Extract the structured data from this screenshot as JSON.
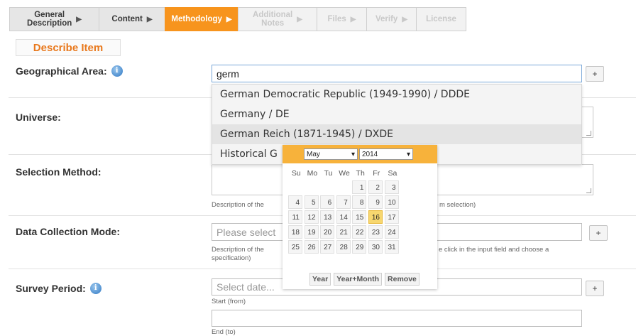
{
  "tabs": [
    {
      "label": "General\nDescription",
      "state": "normal"
    },
    {
      "label": "Content",
      "state": "normal"
    },
    {
      "label": "Methodology",
      "state": "active"
    },
    {
      "label": "Additional\nNotes",
      "state": "disabled"
    },
    {
      "label": "Files",
      "state": "disabled"
    },
    {
      "label": "Verify",
      "state": "disabled"
    },
    {
      "label": "License",
      "state": "disabled"
    }
  ],
  "section_title": "Describe Item",
  "fields": {
    "geo": {
      "label": "Geographical Area:",
      "value": "germ",
      "add": "+"
    },
    "universe": {
      "label": "Universe:"
    },
    "selection": {
      "label": "Selection Method:",
      "hint_left": "Description of the",
      "hint_right": "m selection)"
    },
    "collection": {
      "label": "Data Collection Mode:",
      "placeholder": "Please select",
      "add": "+",
      "hint_left": "Description of the\nspecification)",
      "hint_right": "e click in the input field and choose a"
    },
    "survey": {
      "label": "Survey Period:",
      "start_placeholder": "Select date...",
      "start_hint": "Start (from)",
      "end_hint": "End (to)",
      "add": "+"
    }
  },
  "autocomplete": [
    "German Democratic Republic (1949-1990) / DDDE",
    "Germany / DE",
    "German Reich (1871-1945) / DXDE",
    "Historical G"
  ],
  "datepicker": {
    "month": "May",
    "year": "2014",
    "weekdays": [
      "Su",
      "Mo",
      "Tu",
      "We",
      "Th",
      "Fr",
      "Sa"
    ],
    "weeks": [
      [
        "",
        "",
        "",
        "",
        "1",
        "2",
        "3"
      ],
      [
        "4",
        "5",
        "6",
        "7",
        "8",
        "9",
        "10"
      ],
      [
        "11",
        "12",
        "13",
        "14",
        "15",
        "16",
        "17"
      ],
      [
        "18",
        "19",
        "20",
        "21",
        "22",
        "23",
        "24"
      ],
      [
        "25",
        "26",
        "27",
        "28",
        "29",
        "30",
        "31"
      ]
    ],
    "today": "16",
    "buttons": [
      "Year",
      "Year+Month",
      "Remove"
    ]
  },
  "icons": {
    "info": "info-icon",
    "tab_arrow": "triangle-right-icon",
    "select_arrow": "triangle-down-icon"
  },
  "colors": {
    "accent": "#f7941d",
    "section_title": "#e8781c",
    "datepicker_header": "#f7b23b",
    "today": "#f7d76f"
  }
}
